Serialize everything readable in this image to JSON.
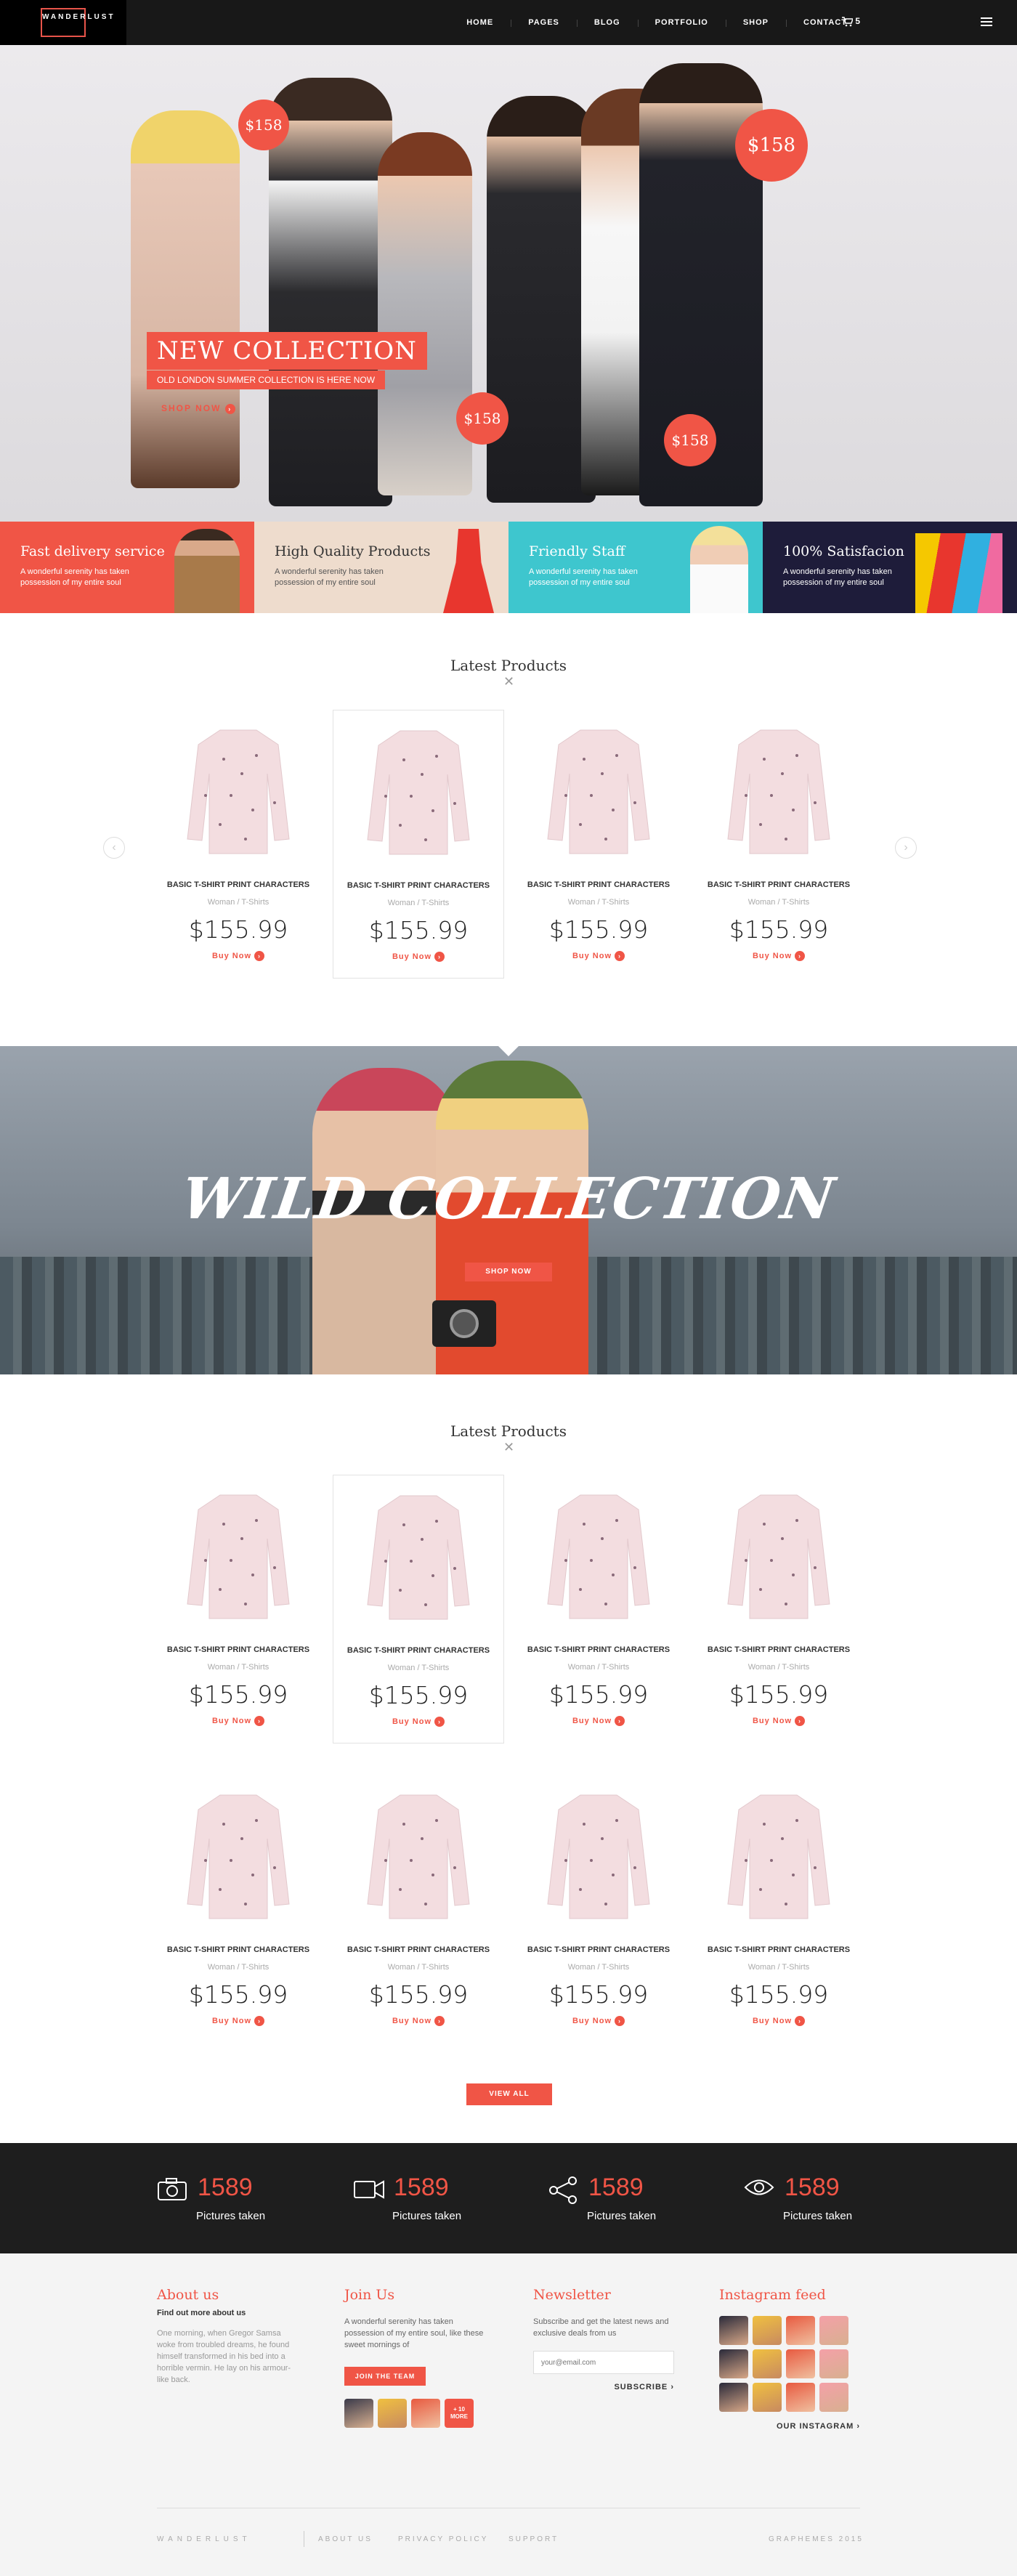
{
  "header": {
    "logo_text": "WANDERLUST",
    "nav": [
      "HOME",
      "PAGES",
      "BLOG",
      "PORTFOLIO",
      "SHOP",
      "CONTACT"
    ],
    "cart_count": "5"
  },
  "hero": {
    "title": "NEW COLLECTION",
    "subtitle": "OLD LONDON SUMMER COLLECTION IS HERE NOW",
    "cta": "SHOP NOW",
    "prices": [
      "$158",
      "$158",
      "$158",
      "$158"
    ]
  },
  "features": [
    {
      "title": "Fast delivery service",
      "text": "A wonderful serenity has taken possession of my entire soul",
      "bg": "#f05546",
      "color": "#ffffff"
    },
    {
      "title": "High Quality Products",
      "text": "A wonderful serenity has taken possession of my entire soul",
      "bg": "#eedccd",
      "color": "#333333"
    },
    {
      "title": "Friendly Staff",
      "text": "A wonderful serenity has taken possession of my entire soul",
      "bg": "#3ec6ce",
      "color": "#ffffff"
    },
    {
      "title": "100% Satisfacion",
      "text": "A wonderful serenity has taken possession of my entire soul",
      "bg": "#1e1c3a",
      "color": "#ffffff"
    }
  ],
  "latest1": {
    "title": "Latest Products",
    "products": [
      {
        "name": "BASIC T-SHIRT PRINT CHARACTERS",
        "category": "Woman / T-Shirts",
        "price": "$155.99",
        "buy": "Buy Now"
      },
      {
        "name": "BASIC T-SHIRT PRINT CHARACTERS",
        "category": "Woman / T-Shirts",
        "price": "$155.99",
        "buy": "Buy Now"
      },
      {
        "name": "BASIC T-SHIRT PRINT CHARACTERS",
        "category": "Woman / T-Shirts",
        "price": "$155.99",
        "buy": "Buy Now"
      },
      {
        "name": "BASIC T-SHIRT PRINT CHARACTERS",
        "category": "Woman / T-Shirts",
        "price": "$155.99",
        "buy": "Buy Now"
      }
    ]
  },
  "wild": {
    "title": "WILD COLLECTION",
    "cta": "SHOP NOW"
  },
  "latest2": {
    "title": "Latest Products",
    "products": [
      {
        "name": "BASIC T-SHIRT PRINT CHARACTERS",
        "category": "Woman / T-Shirts",
        "price": "$155.99",
        "buy": "Buy Now"
      },
      {
        "name": "BASIC T-SHIRT PRINT CHARACTERS",
        "category": "Woman / T-Shirts",
        "price": "$155.99",
        "buy": "Buy Now"
      },
      {
        "name": "BASIC T-SHIRT PRINT CHARACTERS",
        "category": "Woman / T-Shirts",
        "price": "$155.99",
        "buy": "Buy Now"
      },
      {
        "name": "BASIC T-SHIRT PRINT CHARACTERS",
        "category": "Woman / T-Shirts",
        "price": "$155.99",
        "buy": "Buy Now"
      },
      {
        "name": "BASIC T-SHIRT PRINT CHARACTERS",
        "category": "Woman / T-Shirts",
        "price": "$155.99",
        "buy": "Buy Now"
      },
      {
        "name": "BASIC T-SHIRT PRINT CHARACTERS",
        "category": "Woman / T-Shirts",
        "price": "$155.99",
        "buy": "Buy Now"
      },
      {
        "name": "BASIC T-SHIRT PRINT CHARACTERS",
        "category": "Woman / T-Shirts",
        "price": "$155.99",
        "buy": "Buy Now"
      },
      {
        "name": "BASIC T-SHIRT PRINT CHARACTERS",
        "category": "Woman / T-Shirts",
        "price": "$155.99",
        "buy": "Buy Now"
      }
    ],
    "view_all": "VIEW ALL"
  },
  "stats": [
    {
      "icon": "camera-icon",
      "value": "1589",
      "label": "Pictures taken"
    },
    {
      "icon": "video-icon",
      "value": "1589",
      "label": "Pictures taken"
    },
    {
      "icon": "share-icon",
      "value": "1589",
      "label": "Pictures taken"
    },
    {
      "icon": "eye-icon",
      "value": "1589",
      "label": "Pictures taken"
    }
  ],
  "footer": {
    "about": {
      "title": "About us",
      "sub": "Find out more about us",
      "text": "One morning, when Gregor Samsa woke from troubled dreams, he found himself transformed in his bed into a horrible vermin. He lay on his armour-like back."
    },
    "join": {
      "title": "Join Us",
      "text": "A wonderful serenity has taken possession of my entire soul, like these sweet mornings of",
      "button": "JOIN THE TEAM",
      "more": "+ 10 MORE"
    },
    "newsletter": {
      "title": "Newsletter",
      "text": "Subscribe and get the latest news and exclusive deals from us",
      "placeholder": "your@email.com",
      "button": "SUBSCRIBE"
    },
    "instagram": {
      "title": "Instagram feed",
      "link": "OUR INSTAGRAM"
    },
    "bottom": {
      "brand": "WANDERLUST",
      "links": [
        "ABOUT US",
        "PRIVACY POLICY",
        "SUPPORT"
      ],
      "credit": "GRAPHEMES 2015"
    }
  },
  "colors": {
    "accent": "#f05546",
    "dark": "#1e1e1e",
    "footer_bg": "#f4f4f4"
  }
}
